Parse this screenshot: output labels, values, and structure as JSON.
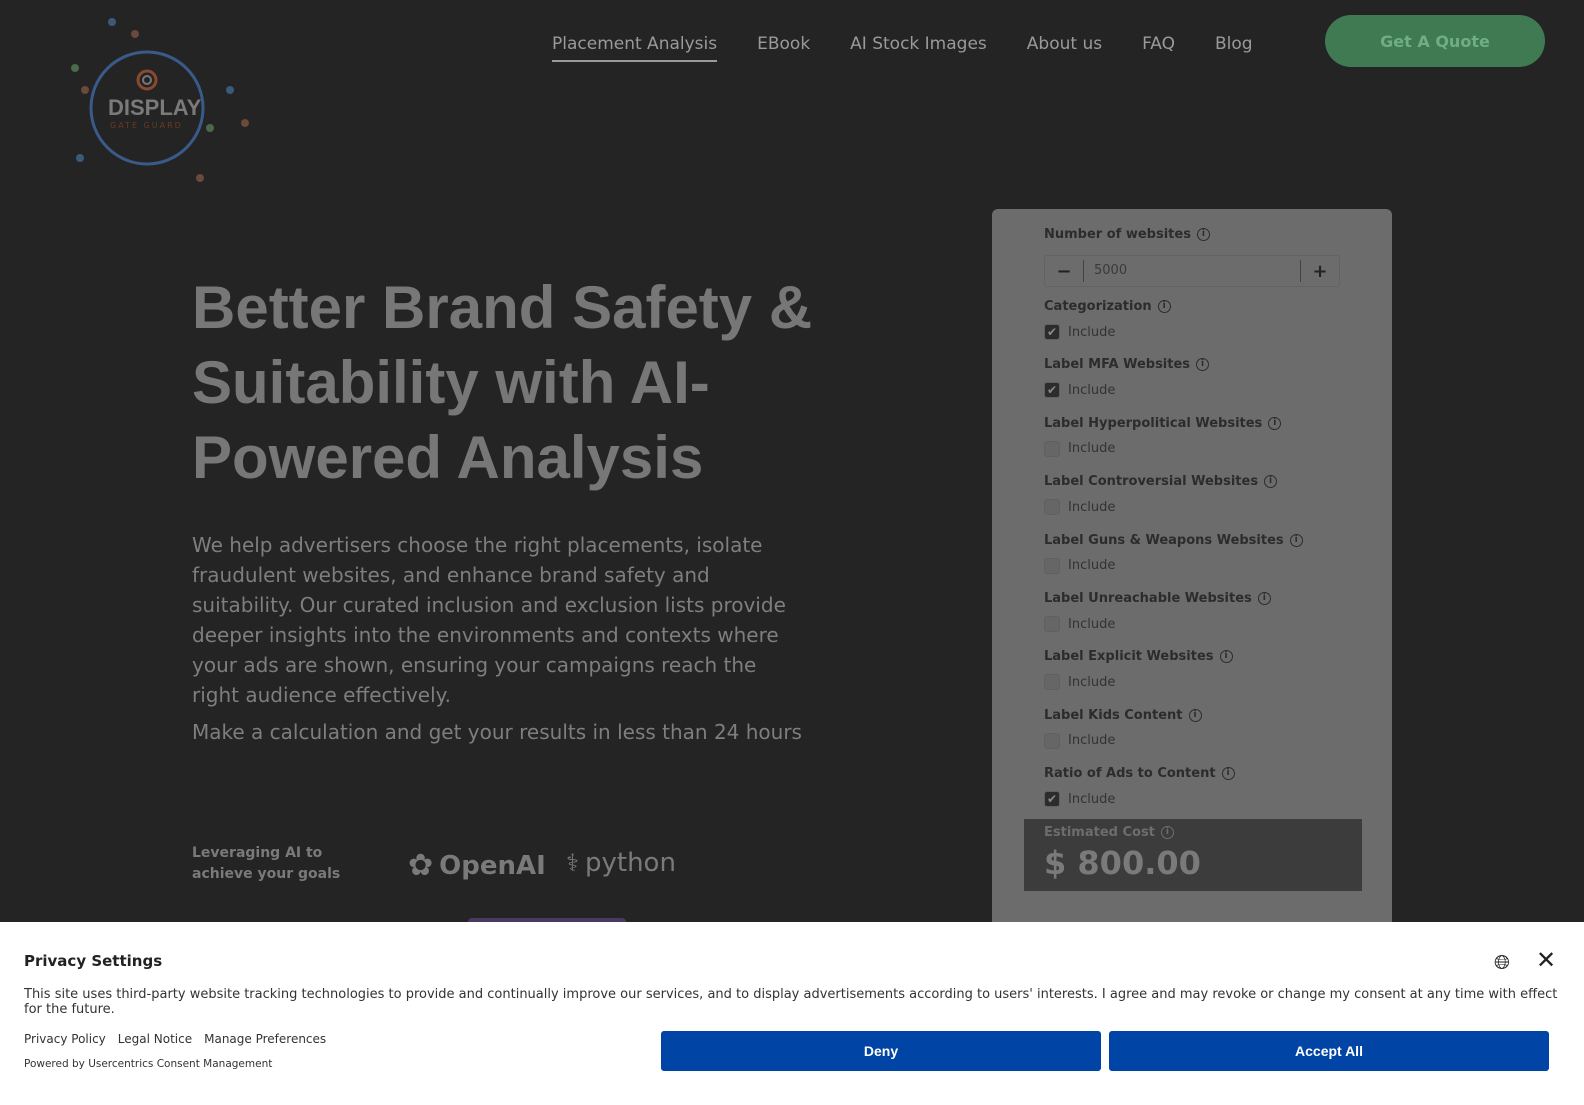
{
  "header": {
    "logo_text": "DISPLAY",
    "logo_sub": "GATE GUARD",
    "nav": [
      "Placement Analysis",
      "EBook",
      "AI Stock Images",
      "About us",
      "FAQ",
      "Blog"
    ],
    "cta": "Get A Quote"
  },
  "hero": {
    "title": "Better Brand Safety & Suitability with AI-Powered Analysis",
    "description": "We help advertisers choose the right placements, isolate fraudulent websites, and enhance brand safety and suitability. Our curated inclusion and exclusion lists provide deeper insights into the environments and contexts where your ads are shown, ensuring your campaigns reach the right audience effectively.",
    "cta_text": "Make a calculation and get your results in less than 24 hours",
    "leveraging": "Leveraging AI to achieve your goals",
    "partners": [
      "OpenAI",
      "python"
    ]
  },
  "calculator": {
    "websites_label": "Number of websites",
    "websites_value": "5000",
    "options": [
      {
        "label": "Categorization",
        "include": "Include",
        "checked": true
      },
      {
        "label": "Label MFA Websites",
        "include": "Include",
        "checked": true
      },
      {
        "label": "Label Hyperpolitical Websites",
        "include": "Include",
        "checked": false
      },
      {
        "label": "Label Controversial Websites",
        "include": "Include",
        "checked": false
      },
      {
        "label": "Label Guns & Weapons Websites",
        "include": "Include",
        "checked": false
      },
      {
        "label": "Label Unreachable Websites",
        "include": "Include",
        "checked": false
      },
      {
        "label": "Label Explicit Websites",
        "include": "Include",
        "checked": false
      },
      {
        "label": "Label Kids Content",
        "include": "Include",
        "checked": false
      },
      {
        "label": "Ratio of Ads to Content",
        "include": "Include",
        "checked": true
      }
    ],
    "cost_label": "Estimated Cost",
    "cost_value": "$ 800.00"
  },
  "consent": {
    "title": "Privacy Settings",
    "text": "This site uses third-party website tracking technologies to provide and continually improve our services, and to display advertisements according to users' interests. I agree and may revoke or change my consent at any time with effect for the future.",
    "links": [
      "Privacy Policy",
      "Legal Notice",
      "Manage Preferences"
    ],
    "powered": "Powered by Usercentrics Consent Management",
    "deny": "Deny",
    "accept": "Accept All"
  }
}
